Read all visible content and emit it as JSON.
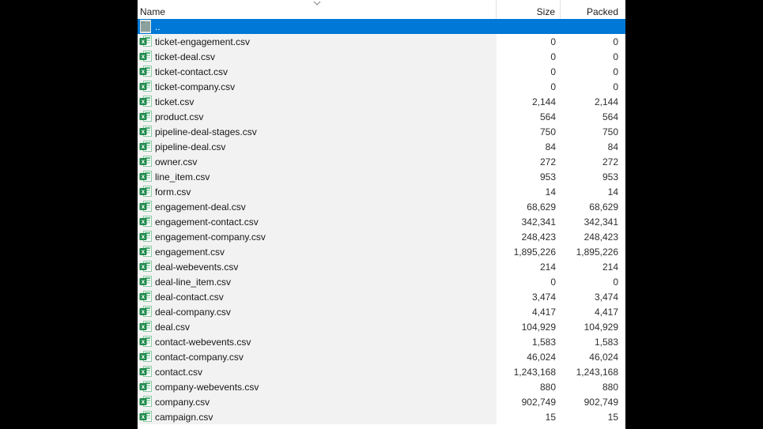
{
  "header": {
    "name": "Name",
    "size": "Size",
    "packed": "Packed",
    "sort_indicator": "chevron-down-icon",
    "sorted_column": "Name"
  },
  "colors": {
    "selection_blue": "#0078d7",
    "name_column_tint": "#f2f2f2",
    "panel_background": "#ffffff",
    "letterbox_black": "#000000",
    "csv_icon_green": "#1f8a4c",
    "up_folder_gray_green": "#8ba19e"
  },
  "selected_index": 0,
  "rows": [
    {
      "name": "..",
      "size": "",
      "packed": "",
      "icon": "up-folder-icon"
    },
    {
      "name": "ticket-engagement.csv",
      "size": "0",
      "packed": "0",
      "icon": "excel-csv-icon"
    },
    {
      "name": "ticket-deal.csv",
      "size": "0",
      "packed": "0",
      "icon": "excel-csv-icon"
    },
    {
      "name": "ticket-contact.csv",
      "size": "0",
      "packed": "0",
      "icon": "excel-csv-icon"
    },
    {
      "name": "ticket-company.csv",
      "size": "0",
      "packed": "0",
      "icon": "excel-csv-icon"
    },
    {
      "name": "ticket.csv",
      "size": "2,144",
      "packed": "2,144",
      "icon": "excel-csv-icon"
    },
    {
      "name": "product.csv",
      "size": "564",
      "packed": "564",
      "icon": "excel-csv-icon"
    },
    {
      "name": "pipeline-deal-stages.csv",
      "size": "750",
      "packed": "750",
      "icon": "excel-csv-icon"
    },
    {
      "name": "pipeline-deal.csv",
      "size": "84",
      "packed": "84",
      "icon": "excel-csv-icon"
    },
    {
      "name": "owner.csv",
      "size": "272",
      "packed": "272",
      "icon": "excel-csv-icon"
    },
    {
      "name": "line_item.csv",
      "size": "953",
      "packed": "953",
      "icon": "excel-csv-icon"
    },
    {
      "name": "form.csv",
      "size": "14",
      "packed": "14",
      "icon": "excel-csv-icon"
    },
    {
      "name": "engagement-deal.csv",
      "size": "68,629",
      "packed": "68,629",
      "icon": "excel-csv-icon"
    },
    {
      "name": "engagement-contact.csv",
      "size": "342,341",
      "packed": "342,341",
      "icon": "excel-csv-icon"
    },
    {
      "name": "engagement-company.csv",
      "size": "248,423",
      "packed": "248,423",
      "icon": "excel-csv-icon"
    },
    {
      "name": "engagement.csv",
      "size": "1,895,226",
      "packed": "1,895,226",
      "icon": "excel-csv-icon"
    },
    {
      "name": "deal-webevents.csv",
      "size": "214",
      "packed": "214",
      "icon": "excel-csv-icon"
    },
    {
      "name": "deal-line_item.csv",
      "size": "0",
      "packed": "0",
      "icon": "excel-csv-icon"
    },
    {
      "name": "deal-contact.csv",
      "size": "3,474",
      "packed": "3,474",
      "icon": "excel-csv-icon"
    },
    {
      "name": "deal-company.csv",
      "size": "4,417",
      "packed": "4,417",
      "icon": "excel-csv-icon"
    },
    {
      "name": "deal.csv",
      "size": "104,929",
      "packed": "104,929",
      "icon": "excel-csv-icon"
    },
    {
      "name": "contact-webevents.csv",
      "size": "1,583",
      "packed": "1,583",
      "icon": "excel-csv-icon"
    },
    {
      "name": "contact-company.csv",
      "size": "46,024",
      "packed": "46,024",
      "icon": "excel-csv-icon"
    },
    {
      "name": "contact.csv",
      "size": "1,243,168",
      "packed": "1,243,168",
      "icon": "excel-csv-icon"
    },
    {
      "name": "company-webevents.csv",
      "size": "880",
      "packed": "880",
      "icon": "excel-csv-icon"
    },
    {
      "name": "company.csv",
      "size": "902,749",
      "packed": "902,749",
      "icon": "excel-csv-icon"
    },
    {
      "name": "campaign.csv",
      "size": "15",
      "packed": "15",
      "icon": "excel-csv-icon"
    }
  ]
}
